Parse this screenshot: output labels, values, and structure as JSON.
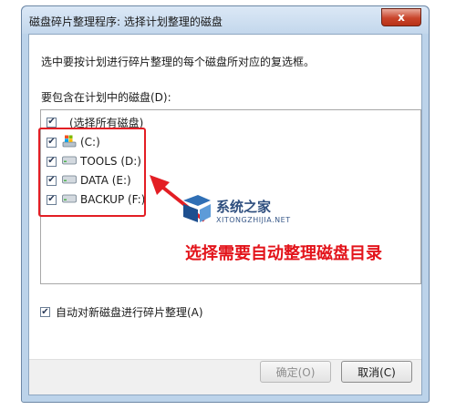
{
  "window": {
    "title": "磁盘碎片整理程序: 选择计划整理的磁盘",
    "close_label": "x"
  },
  "dialog": {
    "instruction": "选中要按计划进行碎片整理的每个磁盘所对应的复选框。",
    "group_label": "要包含在计划中的磁盘(D):",
    "select_all_label": "(选择所有磁盘)",
    "disks": [
      {
        "label": "(C:)",
        "checked": true,
        "icon": "windows-drive-icon"
      },
      {
        "label": "TOOLS (D:)",
        "checked": true,
        "icon": "drive-icon"
      },
      {
        "label": "DATA (E:)",
        "checked": true,
        "icon": "drive-icon"
      },
      {
        "label": "BACKUP (F:)",
        "checked": true,
        "icon": "drive-icon"
      }
    ],
    "auto_defrag_label": "自动对新磁盘进行碎片整理(A)",
    "ok_label": "确定(O)",
    "cancel_label": "取消(C)"
  },
  "overlay": {
    "annotation": "选择需要自动整理磁盘目录",
    "watermark_text": "系统之家",
    "watermark_url": "XITONGZHIJIA.NET",
    "highlight_color": "#e31e24"
  }
}
